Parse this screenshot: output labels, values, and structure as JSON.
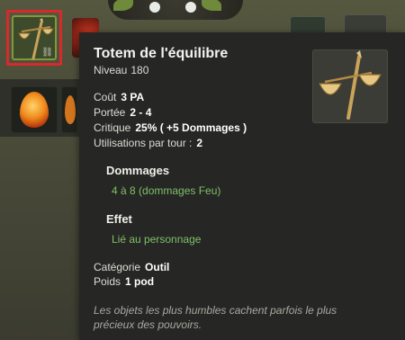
{
  "background": {
    "colors": {
      "selection": "#d8292c",
      "selected_slot": "#7e9a3a"
    }
  },
  "selected_slot": {
    "item_icon": "balance-scale-totem-icon",
    "link_icon": "link-icon",
    "link_glyph": "⛓"
  },
  "tooltip": {
    "title": "Totem de l'équilibre",
    "level_label": "Niveau",
    "level_value": "180",
    "stats": [
      {
        "label": "Coût",
        "value": "3 PA"
      },
      {
        "label": "Portée",
        "value": "2 - 4"
      },
      {
        "label": "Critique",
        "value": "25% ( +5 Dommages )"
      },
      {
        "label": "Utilisations par tour :",
        "value": "2"
      }
    ],
    "damage": {
      "header": "Dommages",
      "value": "4 à 8 (dommages Feu)"
    },
    "effect": {
      "header": "Effet",
      "value": "Lié au personnage"
    },
    "category": {
      "label": "Catégorie",
      "value": "Outil"
    },
    "weight": {
      "label": "Poids",
      "value": "1 pod"
    },
    "flavor": "Les objets les plus humbles cachent parfois le plus précieux des pouvoirs.",
    "colors": {
      "background": "#262624",
      "effect_text": "#7fc06a"
    }
  }
}
